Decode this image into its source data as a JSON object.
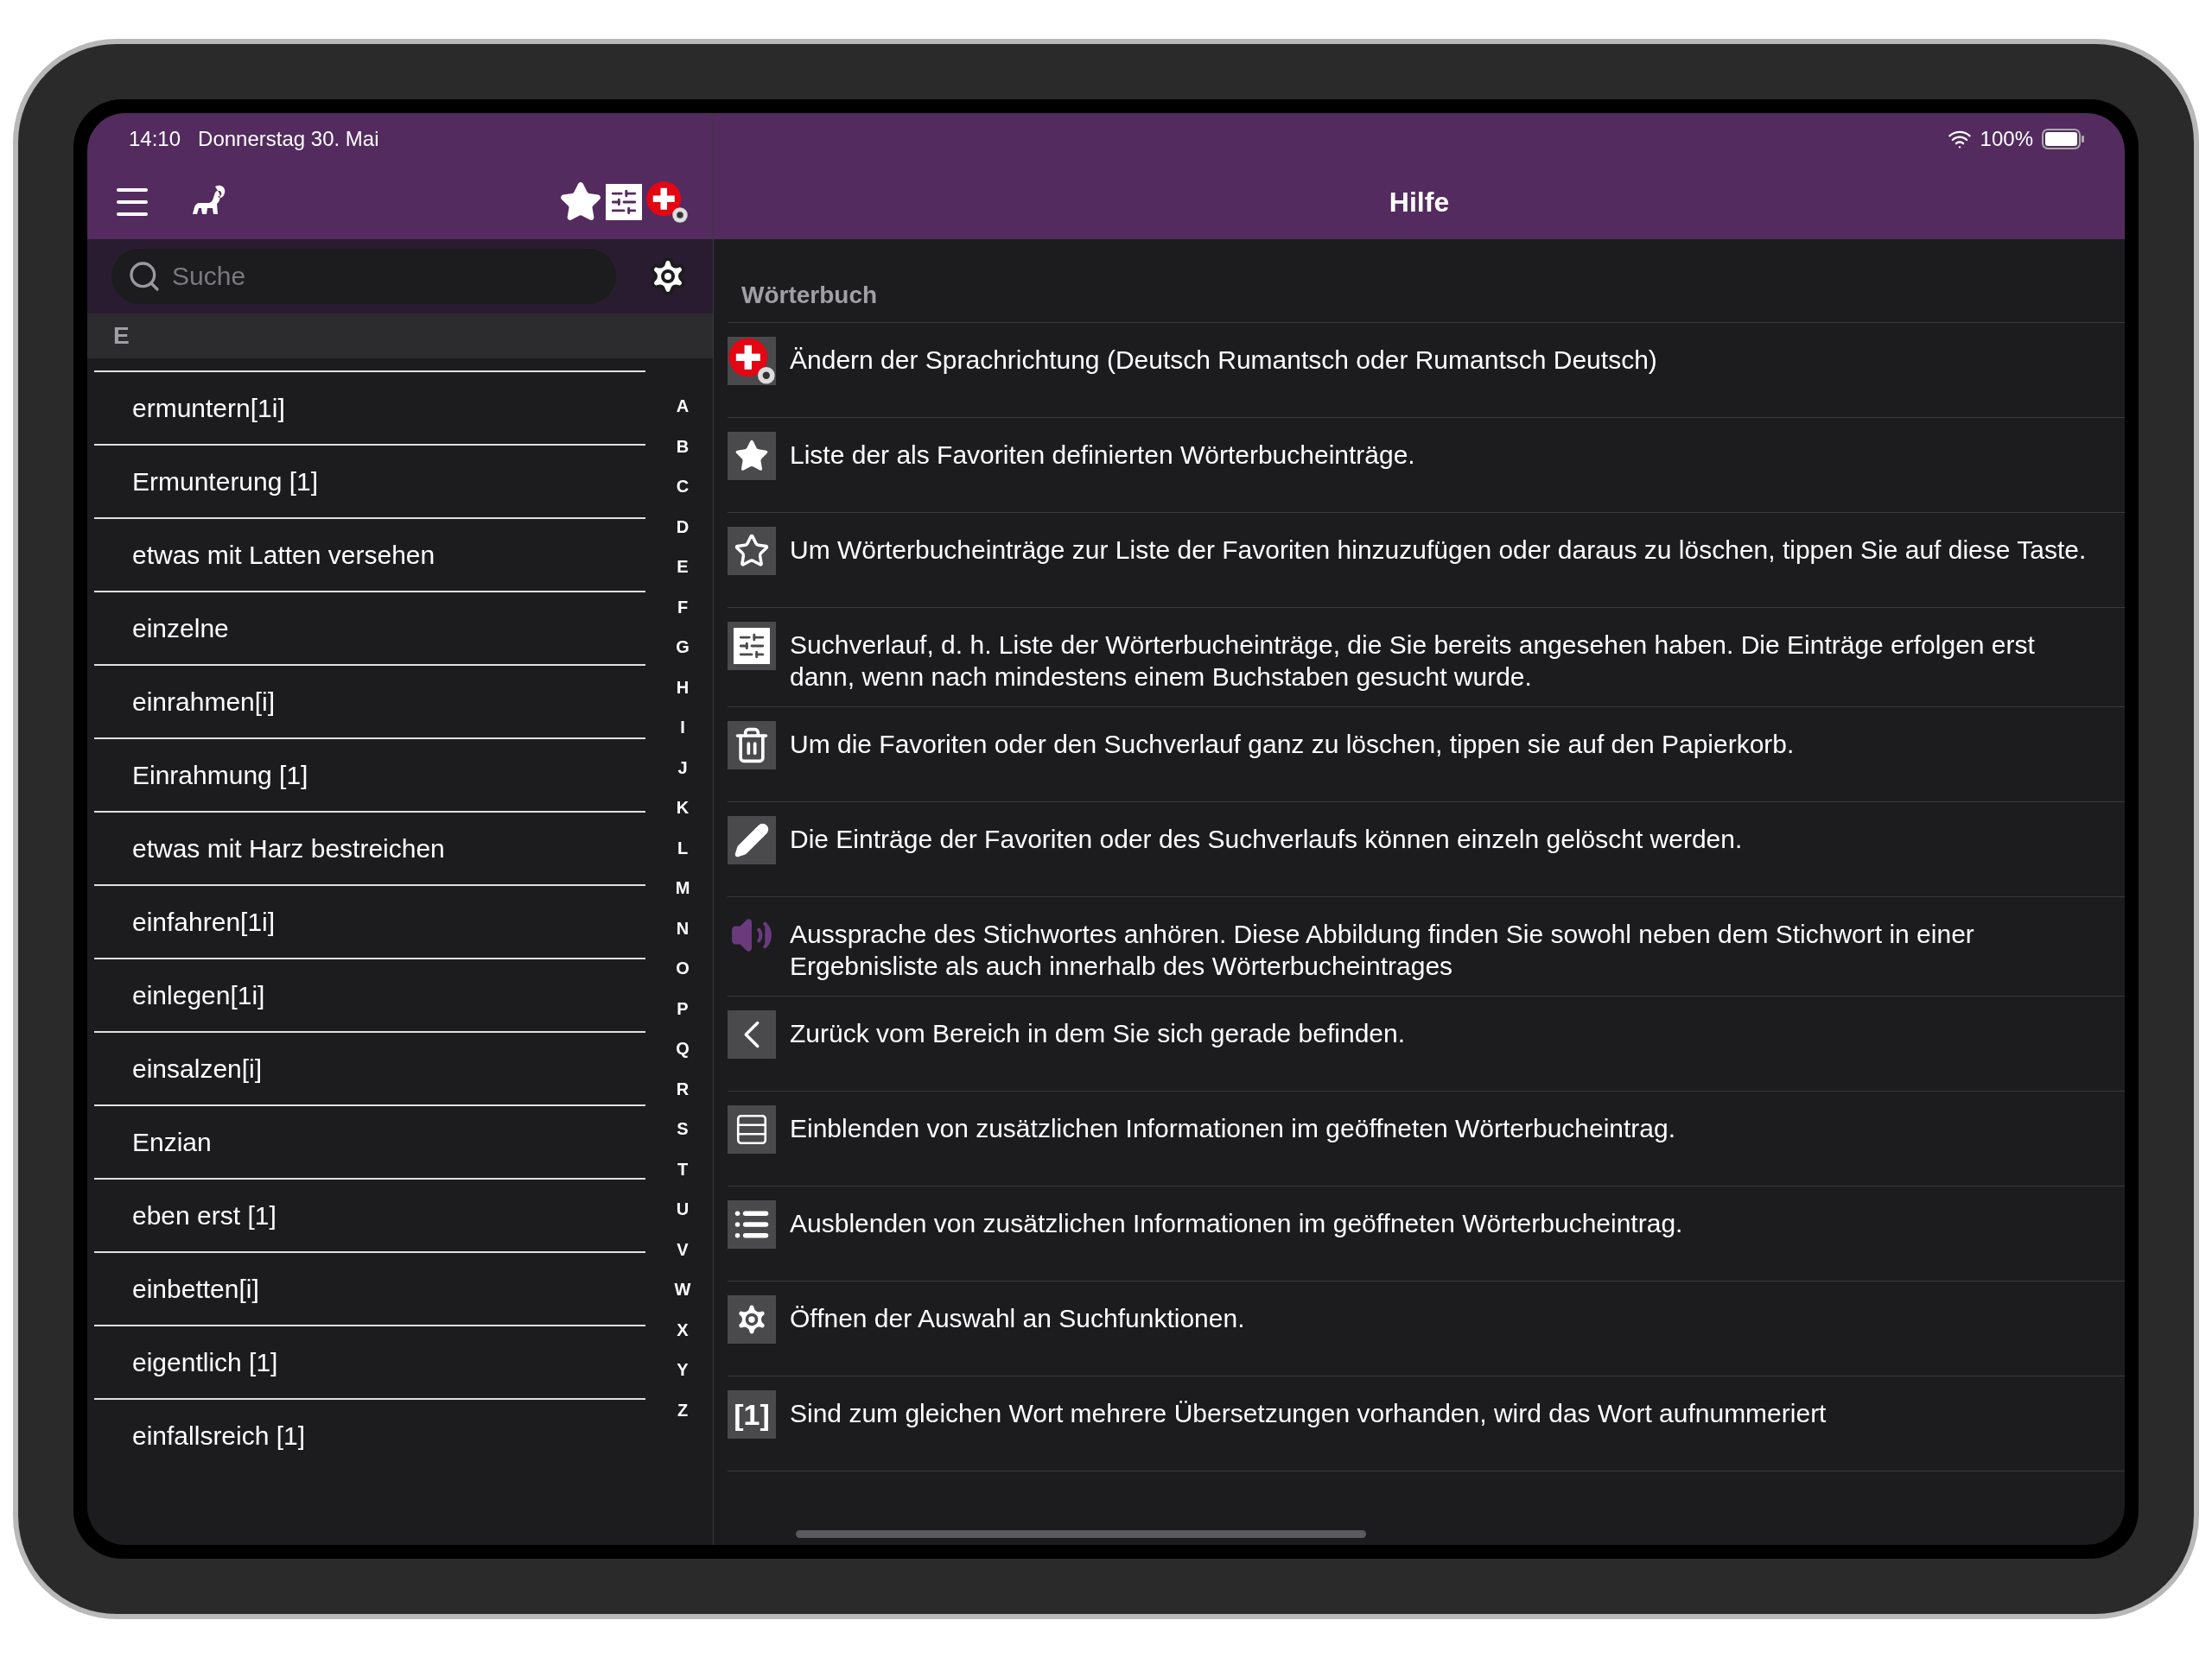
{
  "status_bar": {
    "time": "14:10",
    "date": "Donnerstag 30. Mai",
    "battery": "100%"
  },
  "sidebar": {
    "search": {
      "placeholder": "Suche"
    },
    "section_header": "E",
    "entries": [
      "ermuntern[1i]",
      "Ermunterung [1]",
      "etwas mit Latten versehen",
      "einzelne",
      "einrahmen[i]",
      "Einrahmung [1]",
      "etwas mit Harz bestreichen",
      "einfahren[1i]",
      "einlegen[1i]",
      "einsalzen[i]",
      "Enzian",
      "eben erst [1]",
      "einbetten[i]",
      "eigentlich [1]",
      "einfallsreich [1]"
    ],
    "index_letters": [
      "A",
      "B",
      "C",
      "D",
      "E",
      "F",
      "G",
      "H",
      "I",
      "J",
      "K",
      "L",
      "M",
      "N",
      "O",
      "P",
      "Q",
      "R",
      "S",
      "T",
      "U",
      "V",
      "W",
      "X",
      "Y",
      "Z"
    ]
  },
  "main": {
    "title": "Hilfe",
    "section": "Wörterbuch",
    "help_items": [
      {
        "kind": "flag",
        "text": "Ändern der Sprachrichtung (Deutsch Rumantsch oder Rumantsch Deutsch)"
      },
      {
        "kind": "star",
        "text": "Liste der als Favoriten definierten Wörterbucheinträge."
      },
      {
        "kind": "star-outline",
        "text": "Um Wörterbucheinträge zur Liste der Favoriten hinzuzufügen oder daraus zu löschen, tippen Sie auf diese Taste."
      },
      {
        "kind": "history",
        "text": "Suchverlauf, d. h. Liste der Wörterbucheinträge, die Sie bereits angesehen haben. Die Einträge erfolgen erst dann, wenn nach mindestens einem Buchstaben gesucht wurde."
      },
      {
        "kind": "trash",
        "text": "Um die Favoriten oder den Suchverlauf ganz zu löschen, tippen sie auf den Papierkorb."
      },
      {
        "kind": "pencil",
        "text": "Die Einträge der Favoriten oder des Suchverlaufs können einzeln gelöscht werden."
      },
      {
        "kind": "speaker",
        "text": "Aussprache des Stichwortes anhören. Diese Abbildung finden Sie sowohl neben dem Stichwort in einer Ergebnisliste als auch innerhalb des Wörterbucheintrages"
      },
      {
        "kind": "back",
        "text": "Zurück vom Bereich in dem Sie sich gerade befinden."
      },
      {
        "kind": "list-outline",
        "text": "Einblenden von zusätzlichen Informationen im geöffneten Wörterbucheintrag."
      },
      {
        "kind": "list",
        "text": "Ausblenden von zusätzlichen Informationen im geöffneten Wörterbucheintrag."
      },
      {
        "kind": "gear",
        "text": "Öffnen der Auswahl an Suchfunktionen."
      },
      {
        "kind": "label",
        "icon_text": "[1]",
        "text": "Sind zum gleichen Wort mehrere Übersetzungen vorhanden, wird das Wort aufnummeriert"
      }
    ]
  }
}
